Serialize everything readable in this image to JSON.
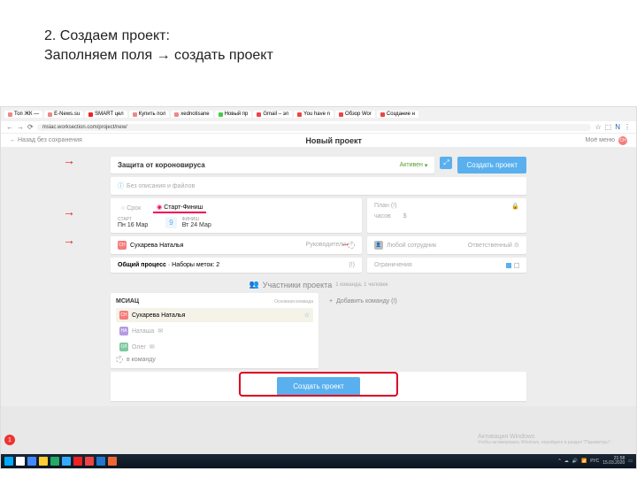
{
  "slide": {
    "line1": "2. Создаем проект:",
    "line2": "Заполняем поля → создать проект"
  },
  "browser": {
    "tabs": [
      "Топ ЖК —",
      "E-News.su",
      "SMART цел",
      "Купить пол",
      "xednotisane",
      "Новый пр",
      "Gmail – эл",
      "You have n",
      "Обзор Wor",
      "Создание н"
    ],
    "url": "msiac.worksection.com/project/new/"
  },
  "header": {
    "back": "← Назад без сохранения",
    "title": "Новый проект",
    "menu": "Моё меню",
    "avatar": "СН"
  },
  "project": {
    "name": "Защита от короновируса",
    "status": "Активен",
    "create": "Создать проект",
    "desc": "Без описания и файлов",
    "time_opts": {
      "term": "Срок",
      "start_finish": "Старт-Финиш"
    },
    "dates": {
      "start_lbl": "СТАРТ",
      "start": "Пн 16 Мар",
      "day": "9",
      "finish_lbl": "ФИНИШ",
      "finish": "Вт 24 Мар"
    },
    "plan": {
      "label": "План (!)",
      "hours": "часов",
      "money": "$"
    },
    "manager": {
      "name": "Сухарева Наталья",
      "role": "Руководители"
    },
    "responsible": {
      "name": "Любой сотрудник",
      "role": "Ответственный"
    },
    "process": {
      "label": "Общий процесс",
      "tags": "Наборы меток: 2"
    },
    "restrictions": "Ограничения"
  },
  "participants": {
    "header": "Участники проекта",
    "sub": "1 команда, 1 человек",
    "team": "МСИАЦ",
    "team_role": "Основная команда",
    "members": [
      "Сухарева Наталья",
      "Наташа",
      "Олег"
    ],
    "add_to_team": "в команду",
    "add_team": "Добавить команду (!)",
    "add": "+"
  },
  "footer_btn": "Создать проект",
  "win": {
    "title": "Активация Windows",
    "sub": "Чтобы активировать Windows, перейдите в раздел \"Параметры\"."
  },
  "clock": {
    "time": "21:58",
    "date": "15.03.2020",
    "lang": "РУС"
  },
  "float_badge": "1"
}
